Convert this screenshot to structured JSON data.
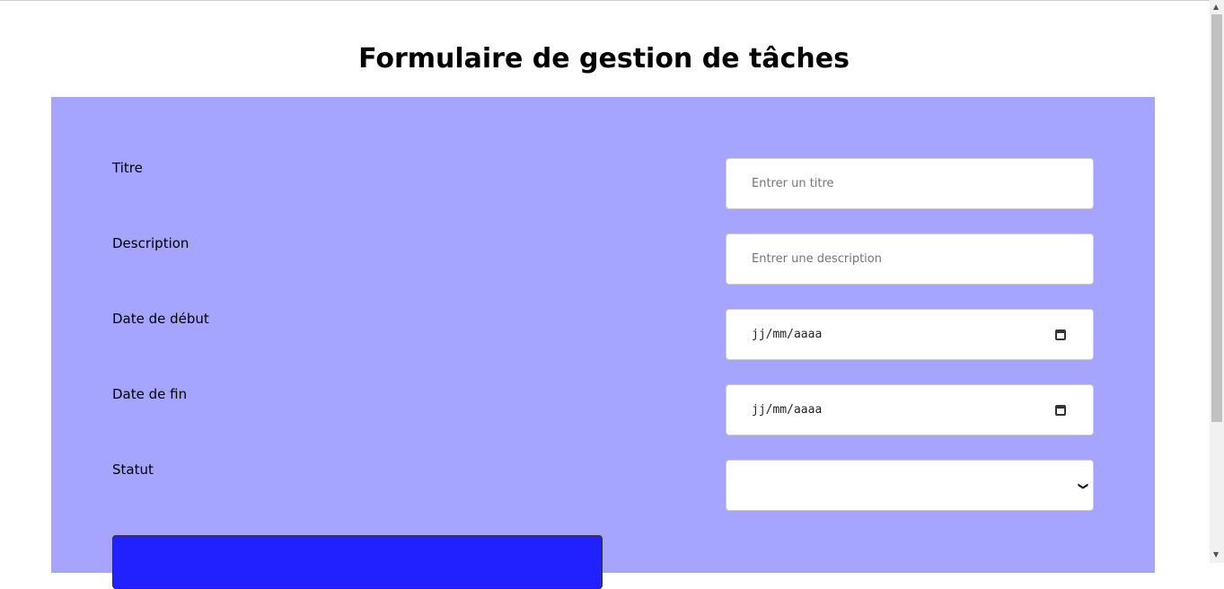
{
  "title": "Formulaire de gestion de tâches",
  "form": {
    "fields": [
      {
        "label": "Titre",
        "placeholder": "Entrer un titre"
      },
      {
        "label": "Description",
        "placeholder": "Entrer une description"
      },
      {
        "label": "Date de début",
        "placeholder": "jj/mm/aaaa"
      },
      {
        "label": "Date de fin",
        "placeholder": "jj/mm/aaaa"
      },
      {
        "label": "Statut",
        "value": ""
      }
    ]
  },
  "colors": {
    "panel": "#a5a5ff",
    "button": "#2121ff"
  }
}
